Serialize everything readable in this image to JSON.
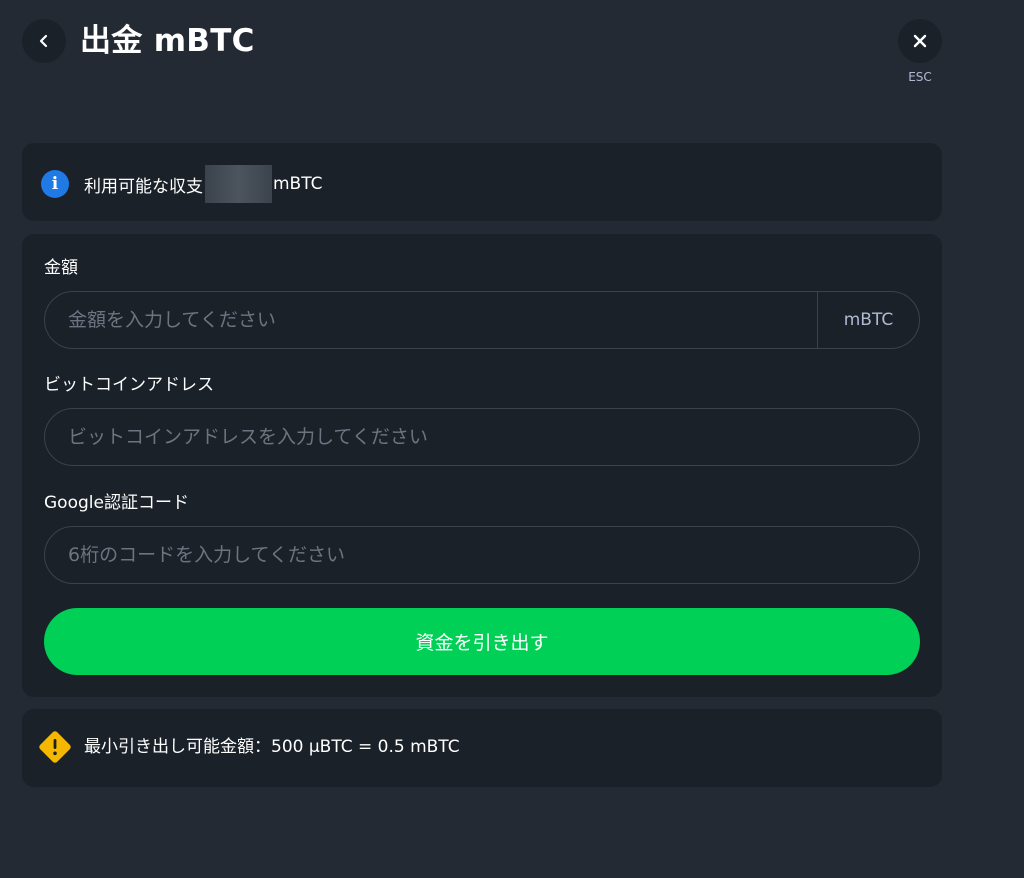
{
  "header": {
    "title": "出金 mBTC",
    "esc_label": "ESC"
  },
  "info": {
    "balance_prefix": "利用可能な収支",
    "balance_unit": "mBTC"
  },
  "form": {
    "amount": {
      "label": "金額",
      "placeholder": "金額を入力してください",
      "value": "",
      "unit": "mBTC"
    },
    "address": {
      "label": "ビットコインアドレス",
      "placeholder": "ビットコインアドレスを入力してください",
      "value": ""
    },
    "google_code": {
      "label": "Google認証コード",
      "placeholder": "6桁のコードを入力してください",
      "value": ""
    },
    "submit_label": "資金を引き出す"
  },
  "warning": {
    "text": "最小引き出し可能金額：500 µBTC = 0.5 mBTC"
  },
  "colors": {
    "background": "#232a34",
    "card": "#1a2129",
    "accent_green": "#00d056",
    "info_blue": "#1f7ae6",
    "warning_yellow": "#f5b700"
  },
  "icons": {
    "back": "chevron-left-icon",
    "close": "close-icon",
    "info": "info-icon",
    "warning": "warning-icon"
  }
}
